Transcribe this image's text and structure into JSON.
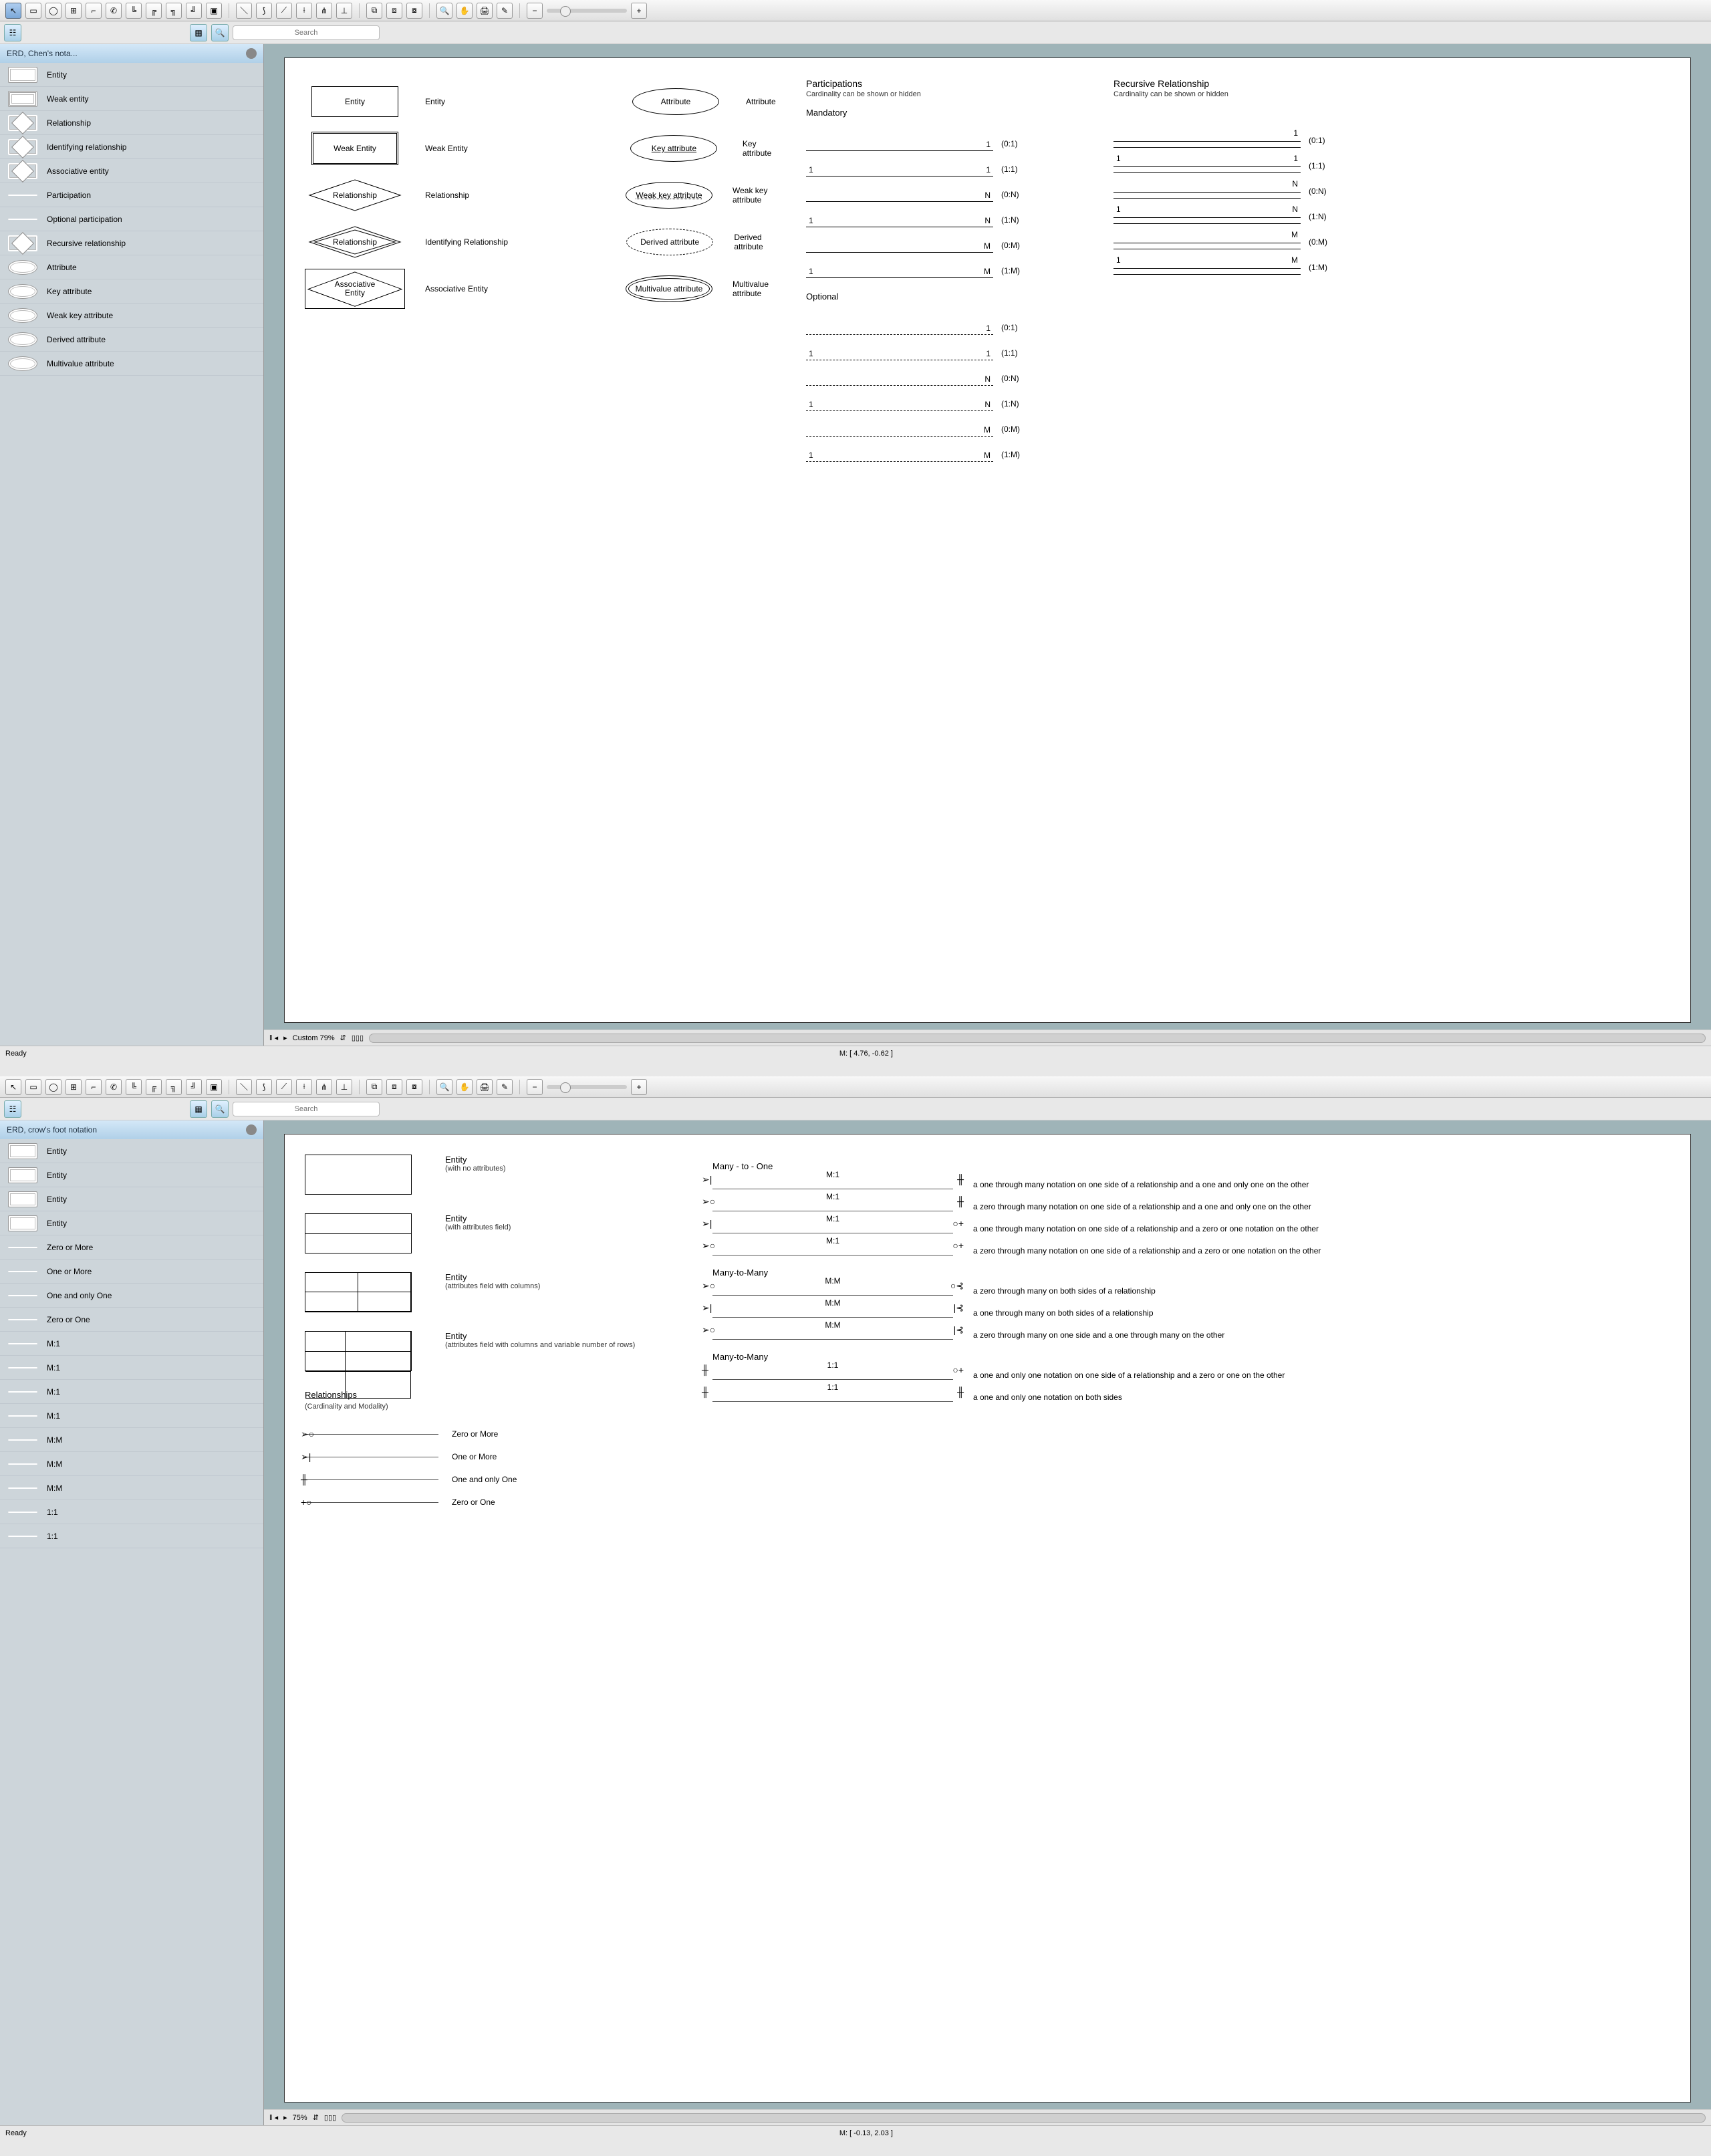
{
  "app1": {
    "search_placeholder": "Search",
    "sidebar_title": "ERD, Chen's nota...",
    "sidebar": [
      "Entity",
      "Weak entity",
      "Relationship",
      "Identifying relationship",
      "Associative entity",
      "Participation",
      "Optional participation",
      "Recursive relationship",
      "Attribute",
      "Key attribute",
      "Weak key attribute",
      "Derived attribute",
      "Multivalue attribute"
    ],
    "canvas": {
      "symbols": [
        {
          "shape": "Entity",
          "label": "Entity"
        },
        {
          "shape": "Weak Entity",
          "label": "Weak Entity"
        },
        {
          "shape": "Relationship",
          "label": "Relationship"
        },
        {
          "shape": "Relationship",
          "label": "Identifying Relationship"
        },
        {
          "shape": "Associative Entity",
          "label": "Associative Entity"
        }
      ],
      "attrs": [
        {
          "shape": "Attribute",
          "label": "Attribute"
        },
        {
          "shape": "Key attribute",
          "label": "Key attribute"
        },
        {
          "shape": "Weak key attribute",
          "label": "Weak key attribute"
        },
        {
          "shape": "Derived attribute",
          "label": "Derived attribute"
        },
        {
          "shape": "Multivalue attribute",
          "label": "Multivalue attribute"
        }
      ],
      "participations": {
        "title": "Participations",
        "sub": "Cardinality can be shown or hidden",
        "mandatory": "Mandatory",
        "rows": [
          {
            "l": "",
            "r": "1",
            "lab": "(0:1)"
          },
          {
            "l": "1",
            "r": "1",
            "lab": "(1:1)"
          },
          {
            "l": "",
            "r": "N",
            "lab": "(0:N)"
          },
          {
            "l": "1",
            "r": "N",
            "lab": "(1:N)"
          },
          {
            "l": "",
            "r": "M",
            "lab": "(0:M)"
          },
          {
            "l": "1",
            "r": "M",
            "lab": "(1:M)"
          }
        ],
        "optional": "Optional",
        "optrows": [
          {
            "l": "",
            "r": "1",
            "lab": "(0:1)"
          },
          {
            "l": "1",
            "r": "1",
            "lab": "(1:1)"
          },
          {
            "l": "",
            "r": "N",
            "lab": "(0:N)"
          },
          {
            "l": "1",
            "r": "N",
            "lab": "(1:N)"
          },
          {
            "l": "",
            "r": "M",
            "lab": "(0:M)"
          },
          {
            "l": "1",
            "r": "M",
            "lab": "(1:M)"
          }
        ]
      },
      "recursive": {
        "title": "Recursive Relationship",
        "sub": "Cardinality can be shown or hidden",
        "rows": [
          {
            "l": "",
            "r": "1",
            "lab": "(0:1)"
          },
          {
            "l": "1",
            "r": "1",
            "lab": "(1:1)"
          },
          {
            "l": "",
            "r": "N",
            "lab": "(0:N)"
          },
          {
            "l": "1",
            "r": "N",
            "lab": "(1:N)"
          },
          {
            "l": "",
            "r": "M",
            "lab": "(0:M)"
          },
          {
            "l": "1",
            "r": "M",
            "lab": "(1:M)"
          }
        ]
      }
    },
    "zoom_label": "Custom 79%",
    "status_left": "Ready",
    "status_mid": "M: [ 4.76, -0.62 ]"
  },
  "app2": {
    "search_placeholder": "Search",
    "sidebar_title": "ERD, crow's foot notation",
    "sidebar": [
      "Entity",
      "Entity",
      "Entity",
      "Entity",
      "Zero or More",
      "One or More",
      "One and only One",
      "Zero or One",
      "M:1",
      "M:1",
      "M:1",
      "M:1",
      "M:M",
      "M:M",
      "M:M",
      "1:1",
      "1:1"
    ],
    "canvas": {
      "entities": [
        {
          "title": "Entity",
          "sub": "(with no attributes)"
        },
        {
          "title": "Entity",
          "sub": "(with attributes field)"
        },
        {
          "title": "Entity",
          "sub": "(attributes field with columns)"
        },
        {
          "title": "Entity",
          "sub": "(attributes field with columns and variable number of rows)"
        }
      ],
      "rel_title": "Relationships",
      "rel_sub": "(Cardinality and Modality)",
      "relsyms": [
        {
          "end": "➢○",
          "label": "Zero or More"
        },
        {
          "end": "➢|",
          "label": "One or More"
        },
        {
          "end": "╫",
          "label": "One and only One"
        },
        {
          "end": "+○",
          "label": "Zero or One"
        }
      ],
      "m1_title": "Many - to - One",
      "m1": [
        {
          "l": "➢|",
          "r": "╫",
          "mid": "M:1",
          "desc": "a one through many notation on one side of a relationship and a one and only one on the other"
        },
        {
          "l": "➢○",
          "r": "╫",
          "mid": "M:1",
          "desc": "a zero through many notation on one side of a relationship and a one and only one on the other"
        },
        {
          "l": "➢|",
          "r": "○+",
          "mid": "M:1",
          "desc": "a one through many notation on one side of a relationship and a zero or one notation on the other"
        },
        {
          "l": "➢○",
          "r": "○+",
          "mid": "M:1",
          "desc": "a zero through many notation on one side of a relationship and a zero or one notation on the other"
        }
      ],
      "mm_title": "Many-to-Many",
      "mm": [
        {
          "l": "➢○",
          "r": "○⊰",
          "mid": "M:M",
          "desc": "a zero through many on both sides of a relationship"
        },
        {
          "l": "➢|",
          "r": "|⊰",
          "mid": "M:M",
          "desc": "a one through many on both sides of a relationship"
        },
        {
          "l": "➢○",
          "r": "|⊰",
          "mid": "M:M",
          "desc": "a zero through many on one side and a one through many on the other"
        }
      ],
      "mm2_title": "Many-to-Many",
      "mm2": [
        {
          "l": "╫",
          "r": "○+",
          "mid": "1:1",
          "desc": "a one and only one notation on one side of a relationship and a zero or one on the other"
        },
        {
          "l": "╫",
          "r": "╫",
          "mid": "1:1",
          "desc": "a one and only one notation on both sides"
        }
      ]
    },
    "zoom_label": "75%",
    "status_left": "Ready",
    "status_mid": "M: [ -0.13, 2.03 ]"
  }
}
